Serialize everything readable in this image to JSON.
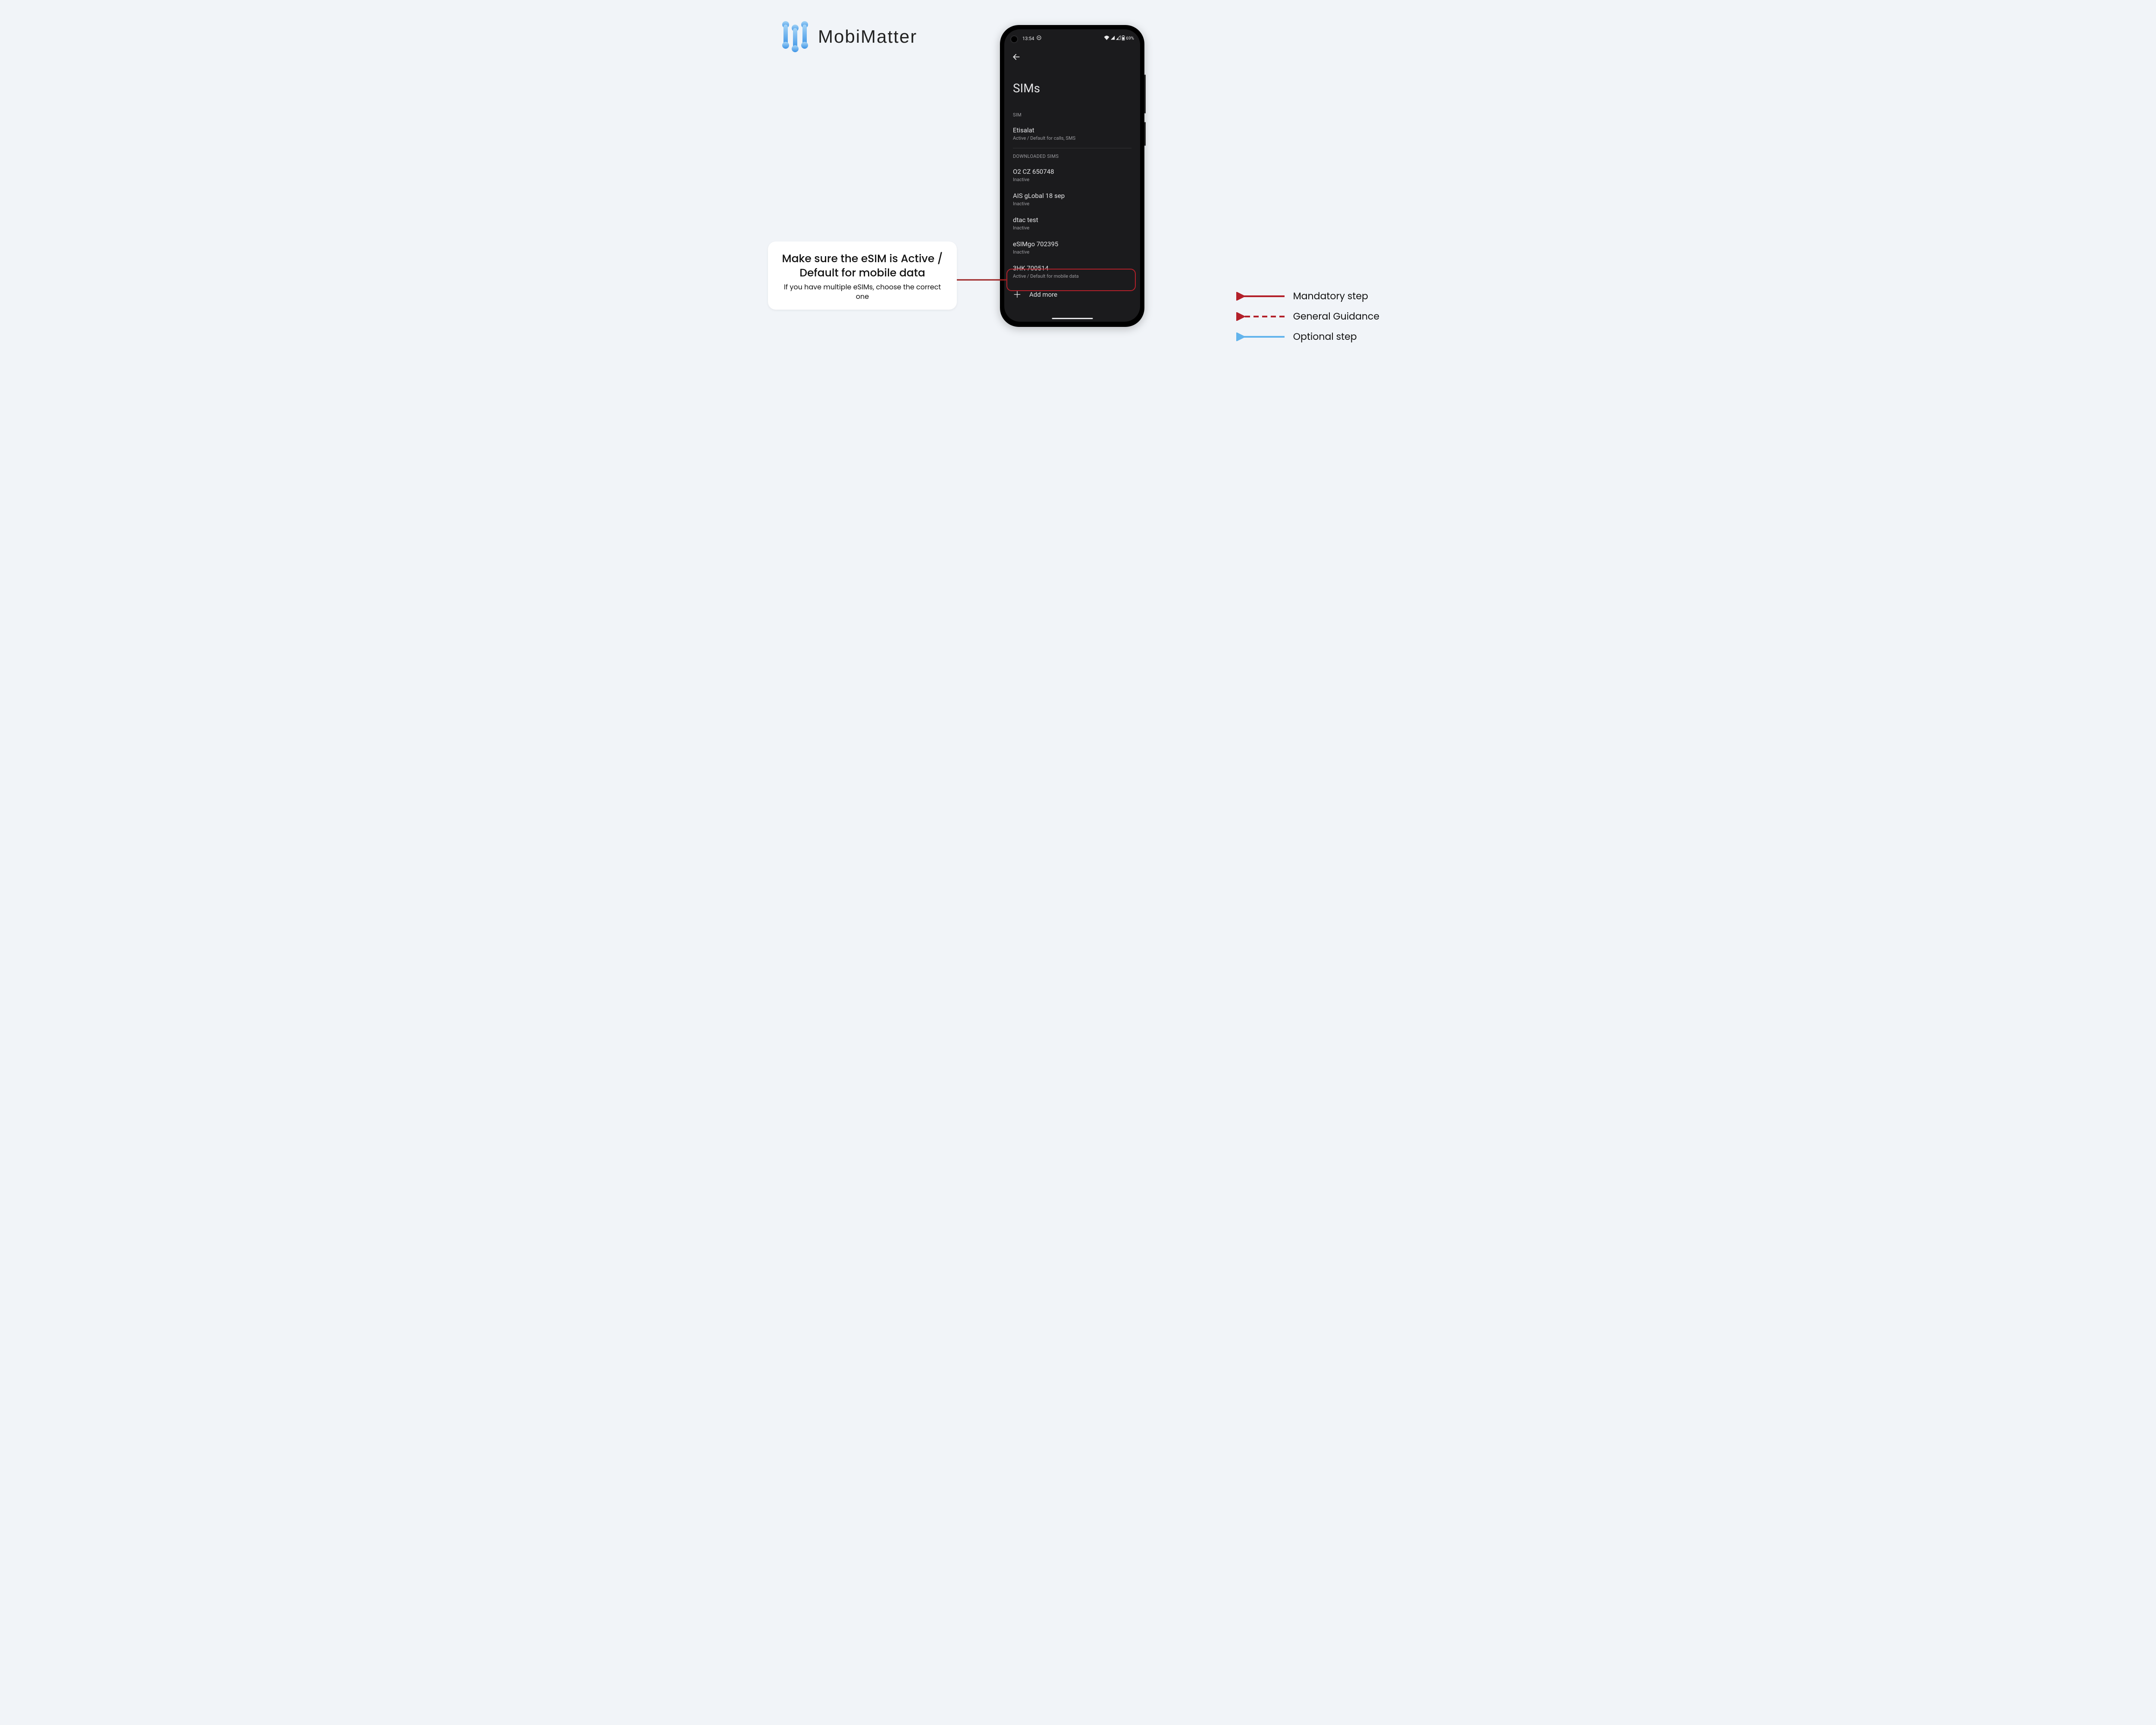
{
  "logo": {
    "text": "MobiMatter"
  },
  "phone": {
    "status": {
      "time": "13:54",
      "battery": "69%"
    },
    "title": "SIMs",
    "section1": "SIM",
    "sim": {
      "name": "Etisalat",
      "sub": "Active / Default for calls, SMS"
    },
    "section2": "DOWNLOADED SIMS",
    "downloads": [
      {
        "name": "O2 CZ 650748",
        "sub": "Inactive"
      },
      {
        "name": "AIS gLobal 18 sep",
        "sub": "Inactive"
      },
      {
        "name": "dtac test",
        "sub": "Inactive"
      },
      {
        "name": "eSIMgo 702395",
        "sub": "Inactive"
      },
      {
        "name": "3HK 700514",
        "sub": "Active / Default for mobile data"
      }
    ],
    "add": "Add more"
  },
  "callout": {
    "title": "Make sure the eSIM is Active / Default for mobile data",
    "sub": "If you have multiple eSIMs, choose the correct one"
  },
  "legend": {
    "mandatory": "Mandatory step",
    "guidance": "General Guidance",
    "optional": "Optional step"
  }
}
